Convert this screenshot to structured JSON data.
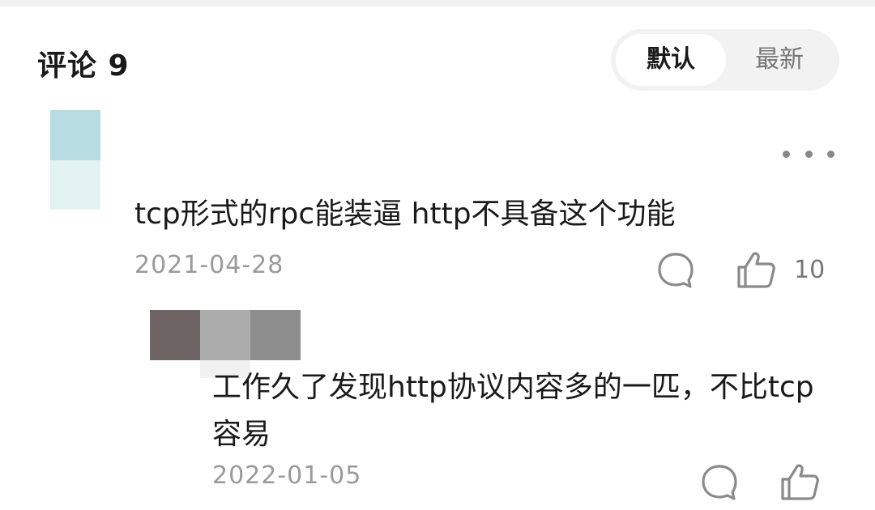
{
  "header": {
    "title": "评论 9"
  },
  "sort": {
    "default_label": "默认",
    "latest_label": "最新",
    "active": "默认"
  },
  "comment": {
    "text": "tcp形式的rpc能装逼 http不具备这个功能",
    "date": "2021-04-28",
    "like_count": "10",
    "icons": [
      "more-icon",
      "comment-icon",
      "like-icon"
    ]
  },
  "reply": {
    "text": "工作久了发现http协议内容多的一匹，不比tcp容易",
    "date": "2022-01-05",
    "icons": [
      "comment-icon",
      "like-icon"
    ]
  },
  "colors": {
    "background": "#ffffff",
    "toggle_bg": "#f2f2f2",
    "text_primary": "#1a1a1a",
    "text_secondary": "#9a9a9a"
  }
}
